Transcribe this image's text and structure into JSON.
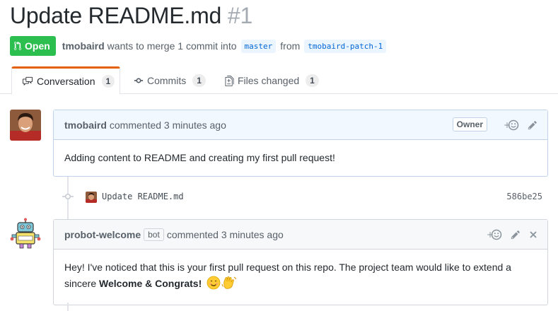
{
  "pr": {
    "title": "Update README.md",
    "number": "#1",
    "state": "Open",
    "author": "tmobaird",
    "merge_text": "wants to merge 1 commit into",
    "base_branch": "master",
    "from_text": "from",
    "head_branch": "tmobaird-patch-1"
  },
  "tabs": [
    {
      "label": "Conversation",
      "count": "1",
      "icon": "comment-discussion-icon"
    },
    {
      "label": "Commits",
      "count": "1",
      "icon": "git-commit-icon"
    },
    {
      "label": "Files changed",
      "count": "1",
      "icon": "file-diff-icon"
    }
  ],
  "comments": [
    {
      "author": "tmobaird",
      "action": "commented 3 minutes ago",
      "label": "Owner",
      "body": "Adding content to README and creating my first pull request!"
    },
    {
      "author": "probot-welcome",
      "bot_label": "bot",
      "action": "commented 3 minutes ago",
      "body_part1": "Hey! I've noticed that this is your first pull request on this repo. The project team would like to extend a sincere",
      "body_bold": "Welcome & Congrats!"
    }
  ],
  "commit": {
    "message": "Update README.md",
    "sha": "586be25"
  },
  "colors": {
    "open_green": "#2cbe4e",
    "tab_accent": "#e36209",
    "link_blue": "#0366d6",
    "comment_header_bg": "#f1f8ff"
  }
}
